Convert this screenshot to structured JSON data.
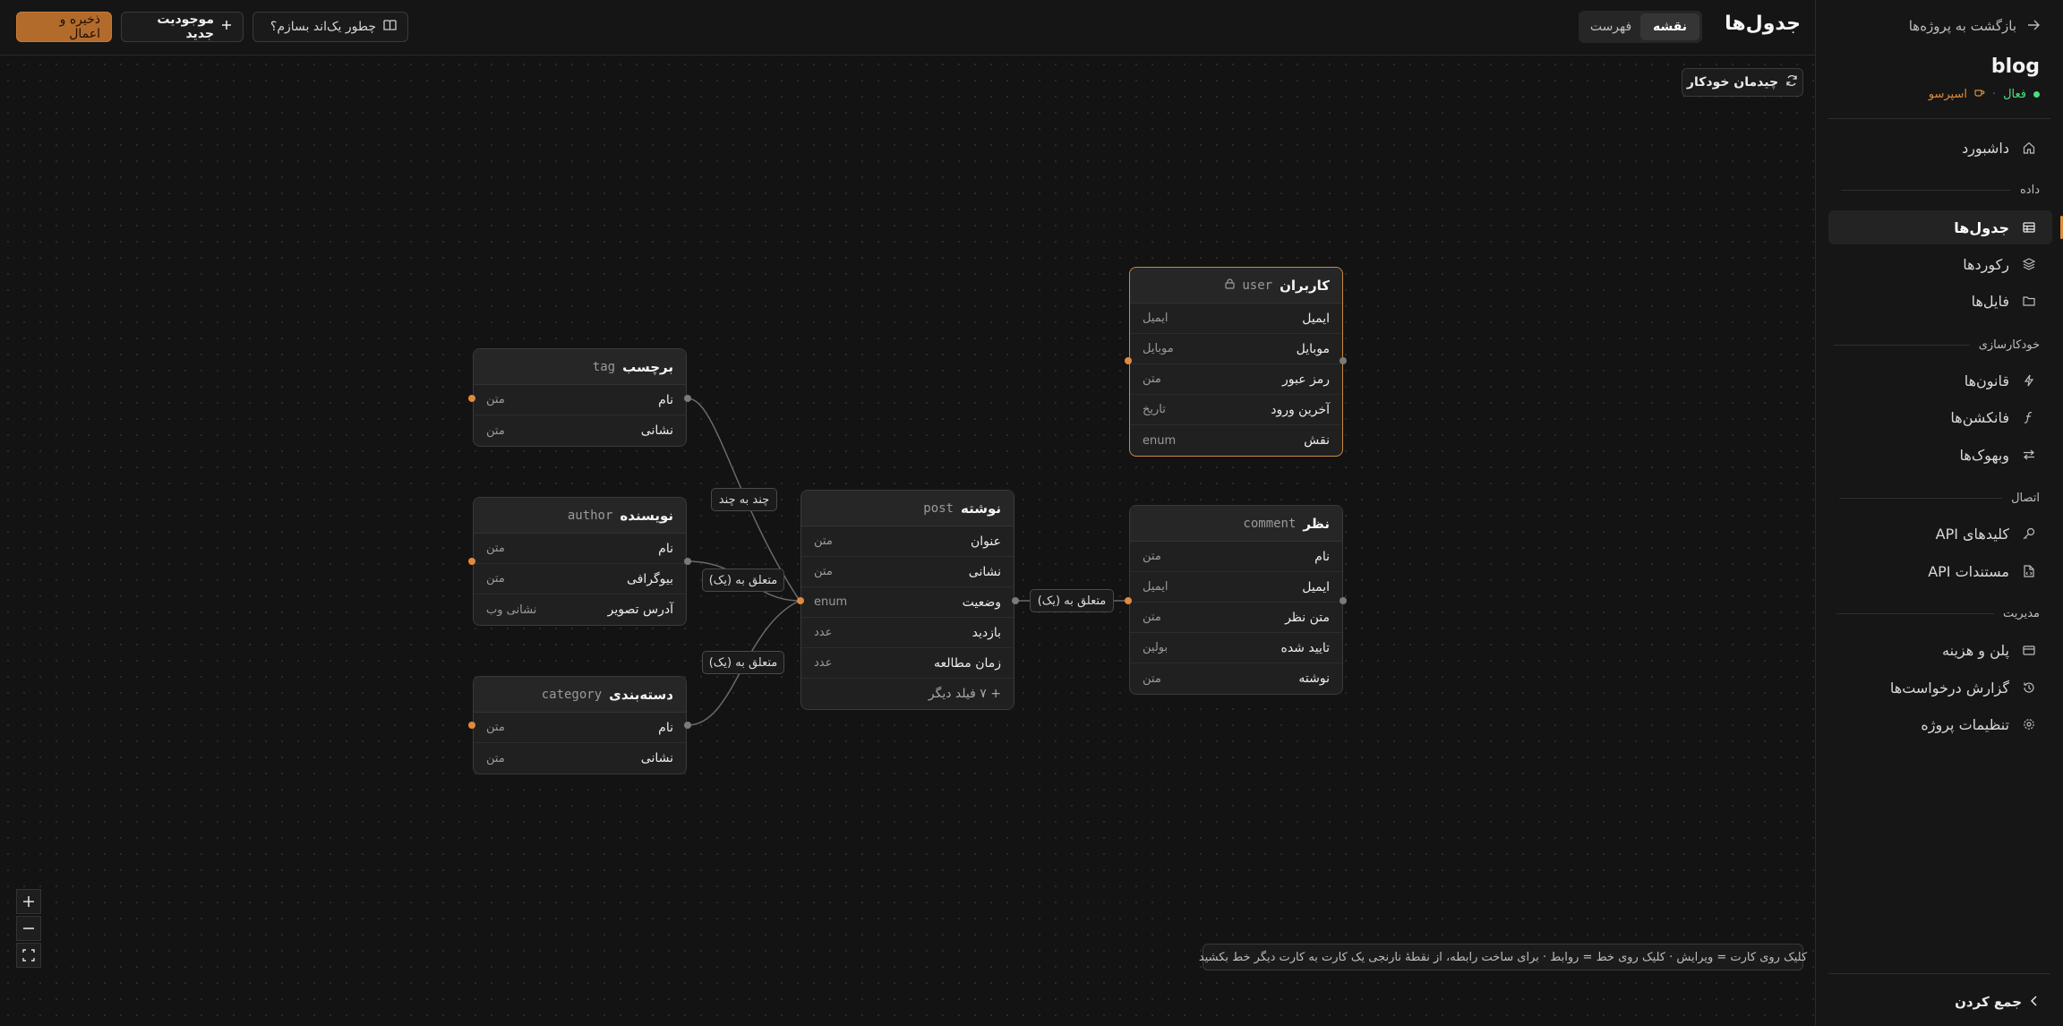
{
  "sidebar": {
    "back_label": "بازگشت به پروژه‌ها",
    "project_name": "blog",
    "status_label": "فعال",
    "plan_label": "اسپرسو",
    "sections": {
      "data": "داده",
      "automation": "خودکارسازی",
      "connection": "اتصال",
      "management": "مدیریت"
    },
    "items": {
      "dashboard": "داشبورد",
      "tables": "جدول‌ها",
      "records": "رکوردها",
      "files": "فایل‌ها",
      "rules": "قانون‌ها",
      "functions": "فانکشن‌ها",
      "webhooks": "وبهوک‌ها",
      "api_keys": "کلیدهای API",
      "api_docs": "مستندات API",
      "billing": "پلن و هزینه",
      "request_logs": "گزارش درخواست‌ها",
      "project_settings": "تنظیمات پروژه"
    },
    "collapse_label": "جمع کردن"
  },
  "header": {
    "title": "جدول‌ها",
    "view_map": "نقشه",
    "view_list": "فهرست",
    "help_label": "چطور یک‌اند بسازم؟",
    "new_entity_label": "موجودیت جدید",
    "save_label": "ذخیره و اعمال"
  },
  "canvas": {
    "auto_layout_label": "چیدمان خودکار",
    "hint": "کلیک روی کارت = ویرایش · کلیک روی خط = روابط · برای ساخت رابطه، از نقطهٔ نارنجی یک کارت به کارت دیگر خط بکشید",
    "edge_labels": {
      "many_to_many": "چند به چند",
      "author_belongs": "متعلق به (یک)",
      "category_belongs": "متعلق به (یک)",
      "comment_belongs": "متعلق به (یک)"
    },
    "cards": {
      "user": {
        "title": "کاربران",
        "slug": "user",
        "fields": [
          {
            "name": "ایمیل",
            "type": "ایمیل"
          },
          {
            "name": "موبایل",
            "type": "موبایل"
          },
          {
            "name": "رمز عبور",
            "type": "متن"
          },
          {
            "name": "آخرین ورود",
            "type": "تاریخ"
          },
          {
            "name": "نقش",
            "type": "enum"
          }
        ]
      },
      "tag": {
        "title": "برچسب",
        "slug": "tag",
        "fields": [
          {
            "name": "نام",
            "type": "متن"
          },
          {
            "name": "نشانی",
            "type": "متن"
          }
        ]
      },
      "author": {
        "title": "نویسنده",
        "slug": "author",
        "fields": [
          {
            "name": "نام",
            "type": "متن"
          },
          {
            "name": "بیوگرافی",
            "type": "متن"
          },
          {
            "name": "آدرس تصویر",
            "type": "نشانی وب"
          }
        ]
      },
      "category": {
        "title": "دسته‌بندی",
        "slug": "category",
        "fields": [
          {
            "name": "نام",
            "type": "متن"
          },
          {
            "name": "نشانی",
            "type": "متن"
          }
        ]
      },
      "post": {
        "title": "نوشته",
        "slug": "post",
        "fields": [
          {
            "name": "عنوان",
            "type": "متن"
          },
          {
            "name": "نشانی",
            "type": "متن"
          },
          {
            "name": "وضعیت",
            "type": "enum"
          },
          {
            "name": "بازدید",
            "type": "عدد"
          },
          {
            "name": "زمان مطالعه",
            "type": "عدد"
          }
        ],
        "more_label": "+ ۷ فیلد دیگر"
      },
      "comment": {
        "title": "نظر",
        "slug": "comment",
        "fields": [
          {
            "name": "نام",
            "type": "متن"
          },
          {
            "name": "ایمیل",
            "type": "ایمیل"
          },
          {
            "name": "متن نظر",
            "type": "متن"
          },
          {
            "name": "تایید شده",
            "type": "بولین"
          },
          {
            "name": "نوشته",
            "type": "متن"
          }
        ]
      }
    }
  },
  "colors": {
    "accent": "#e08a3c",
    "active_green": "#4ade80",
    "background": "#131313"
  }
}
